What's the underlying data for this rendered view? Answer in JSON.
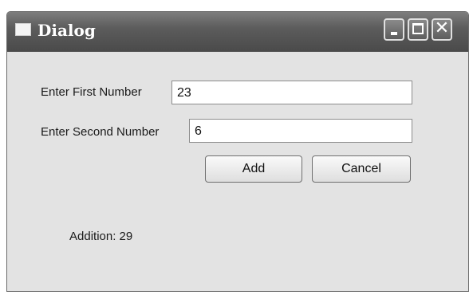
{
  "window": {
    "title": "Dialog"
  },
  "form": {
    "first_label": "Enter First Number",
    "first_value": "23",
    "second_label": "Enter Second Number",
    "second_value": "6"
  },
  "buttons": {
    "add": "Add",
    "cancel": "Cancel"
  },
  "result": {
    "text": "Addition: 29"
  },
  "icons": {
    "close_glyph": "✕"
  }
}
